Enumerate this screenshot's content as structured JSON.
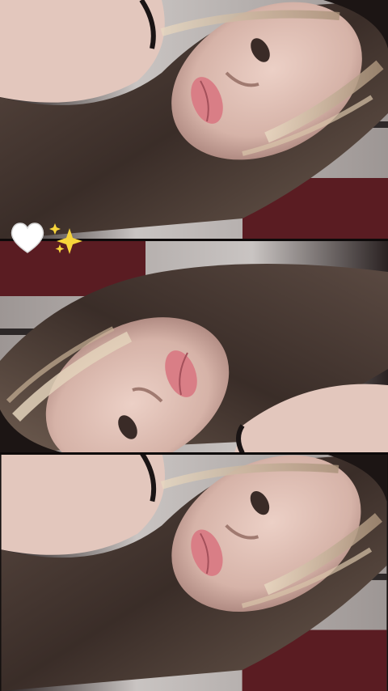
{
  "photo": {
    "description_tags": [
      "selfie",
      "collage",
      "three-panel"
    ],
    "colors": {
      "skin": "#d9b7ad",
      "skin_shadow": "#b08a82",
      "hair_dark": "#4a3a33",
      "hair_light": "#c9b49a",
      "lips": "#d97e86",
      "wall": "#c9c4c2",
      "maroon": "#5a1c22",
      "dark": "#1b1515"
    }
  },
  "stickers": {
    "heart": "white-heart-icon",
    "sparkles": "sparkles-icon"
  }
}
